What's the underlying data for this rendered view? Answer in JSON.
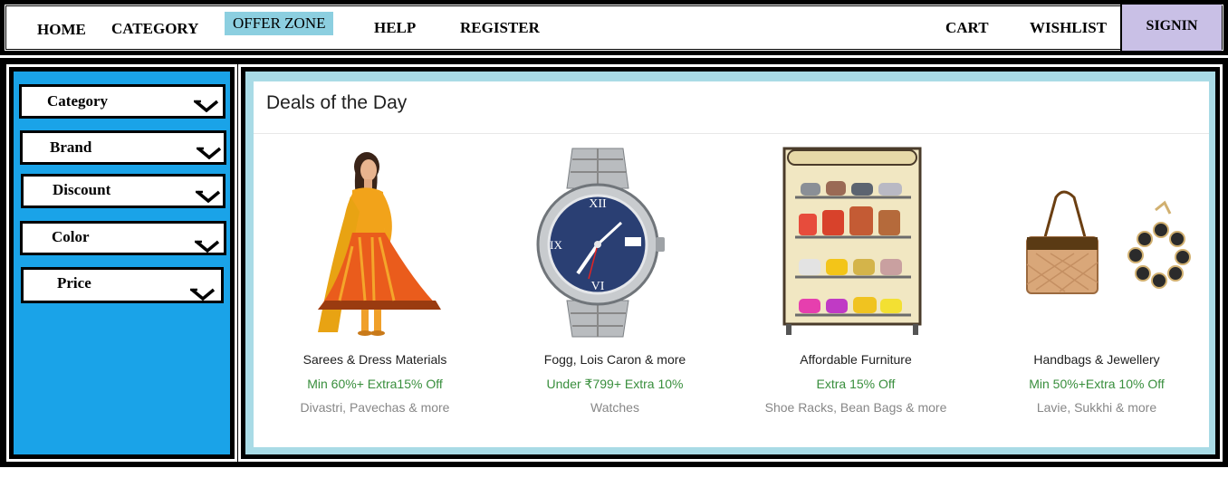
{
  "nav": {
    "home": "HOME",
    "category": "CATEGORY",
    "offer_zone": "OFFER ZONE",
    "help": "HELP",
    "register": "REGISTER",
    "cart": "CART",
    "wishlist": "WISHLIST",
    "signin": "SIGNIN"
  },
  "sidebar": {
    "filters": [
      {
        "label": "Category"
      },
      {
        "label": "Brand"
      },
      {
        "label": "Discount"
      },
      {
        "label": "Color"
      },
      {
        "label": "Price"
      }
    ]
  },
  "deals": {
    "title": "Deals of the Day",
    "items": [
      {
        "name": "Sarees & Dress Materials",
        "offer": "Min 60%+ Extra15% Off",
        "sub": "Divastri, Pavechas & more",
        "icon": "dress-model-image"
      },
      {
        "name": "Fogg, Lois Caron & more",
        "offer": "Under ₹799+ Extra 10%",
        "sub": "Watches",
        "icon": "wristwatch-image"
      },
      {
        "name": "Affordable Furniture",
        "offer": "Extra 15% Off",
        "sub": "Shoe Racks, Bean Bags & more",
        "icon": "shoe-rack-image"
      },
      {
        "name": "Handbags & Jewellery",
        "offer": "Min 50%+Extra 10% Off",
        "sub": "Lavie, Sukkhi & more",
        "icon": "handbag-bracelet-image"
      }
    ]
  },
  "colors": {
    "offer_highlight": "#8ccfe0",
    "signin_bg": "#c9c0e6",
    "sidebar_bg": "#1aa3e8",
    "panel_border": "#a9dbe6",
    "offer_text": "#388e3c"
  }
}
